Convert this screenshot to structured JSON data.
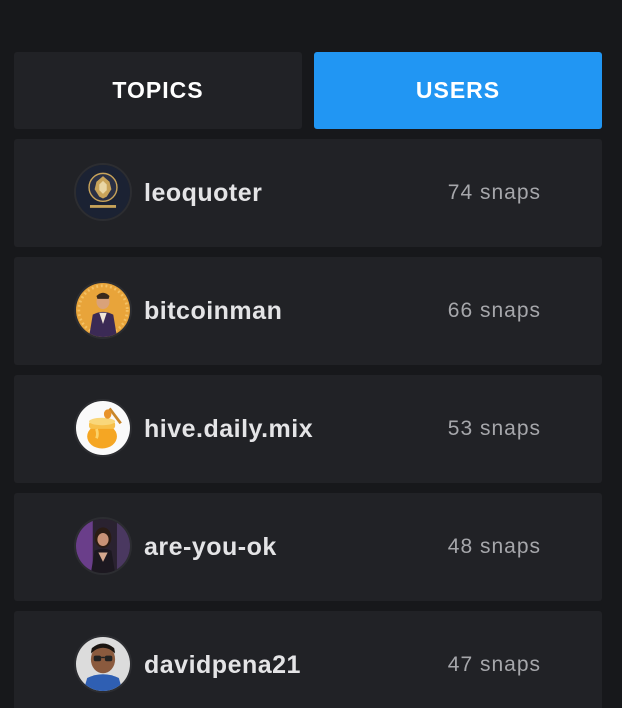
{
  "tabs": {
    "topics_label": "TOPICS",
    "users_label": "USERS",
    "active": "users"
  },
  "colors": {
    "background": "#17181b",
    "card": "#212226",
    "accent": "#2196f3",
    "username_text": "#e4e4e6",
    "count_text": "#a6a7ab"
  },
  "users": [
    {
      "username": "leoquoter",
      "snaps": "74 snaps",
      "avatar_icon": "lion-logo-icon"
    },
    {
      "username": "bitcoinman",
      "snaps": "66 snaps",
      "avatar_icon": "person-portrait-icon"
    },
    {
      "username": "hive.daily.mix",
      "snaps": "53 snaps",
      "avatar_icon": "honey-pot-icon"
    },
    {
      "username": "are-you-ok",
      "snaps": "48 snaps",
      "avatar_icon": "person-photo-icon"
    },
    {
      "username": "davidpena21",
      "snaps": "47 snaps",
      "avatar_icon": "person-glasses-icon"
    }
  ]
}
